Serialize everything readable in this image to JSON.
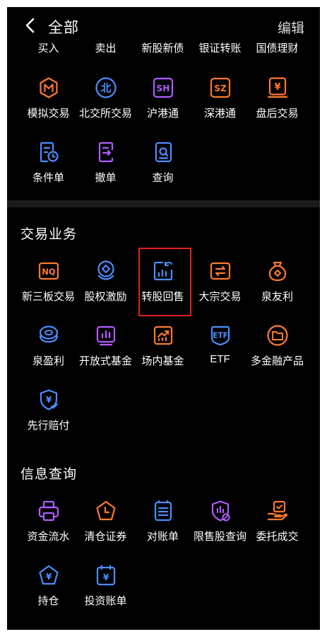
{
  "header": {
    "title": "全部",
    "edit": "编辑"
  },
  "partial_row": [
    "买入",
    "卖出",
    "新股新债",
    "银证转账",
    "国债理财"
  ],
  "trade_rows": [
    [
      "模拟交易",
      "北交所交易",
      "沪港通",
      "深港通",
      "盘后交易"
    ],
    [
      "条件单",
      "撤单",
      "查询"
    ]
  ],
  "sections": {
    "business": {
      "title": "交易业务",
      "items": [
        "新三板交易",
        "股权激励",
        "转股回售",
        "大宗交易",
        "泉友利",
        "泉盈利",
        "开放式基金",
        "场内基金",
        "ETF",
        "多金融产品",
        "先行赔付"
      ]
    },
    "info": {
      "title": "信息查询",
      "items": [
        "资金流水",
        "清仓证券",
        "对账单",
        "限售股查询",
        "委托成交",
        "持仓",
        "投资账单"
      ]
    }
  },
  "icon_text": {
    "nq": "NQ",
    "bei": "北",
    "sh": "SH",
    "sz": "SZ",
    "yen": "¥",
    "etf": "ETF"
  },
  "colors": {
    "orange": "#ff7a2e",
    "blue": "#4d8dff",
    "purple": "#b05cff",
    "highlight": "#e02020",
    "background": "#000000"
  }
}
